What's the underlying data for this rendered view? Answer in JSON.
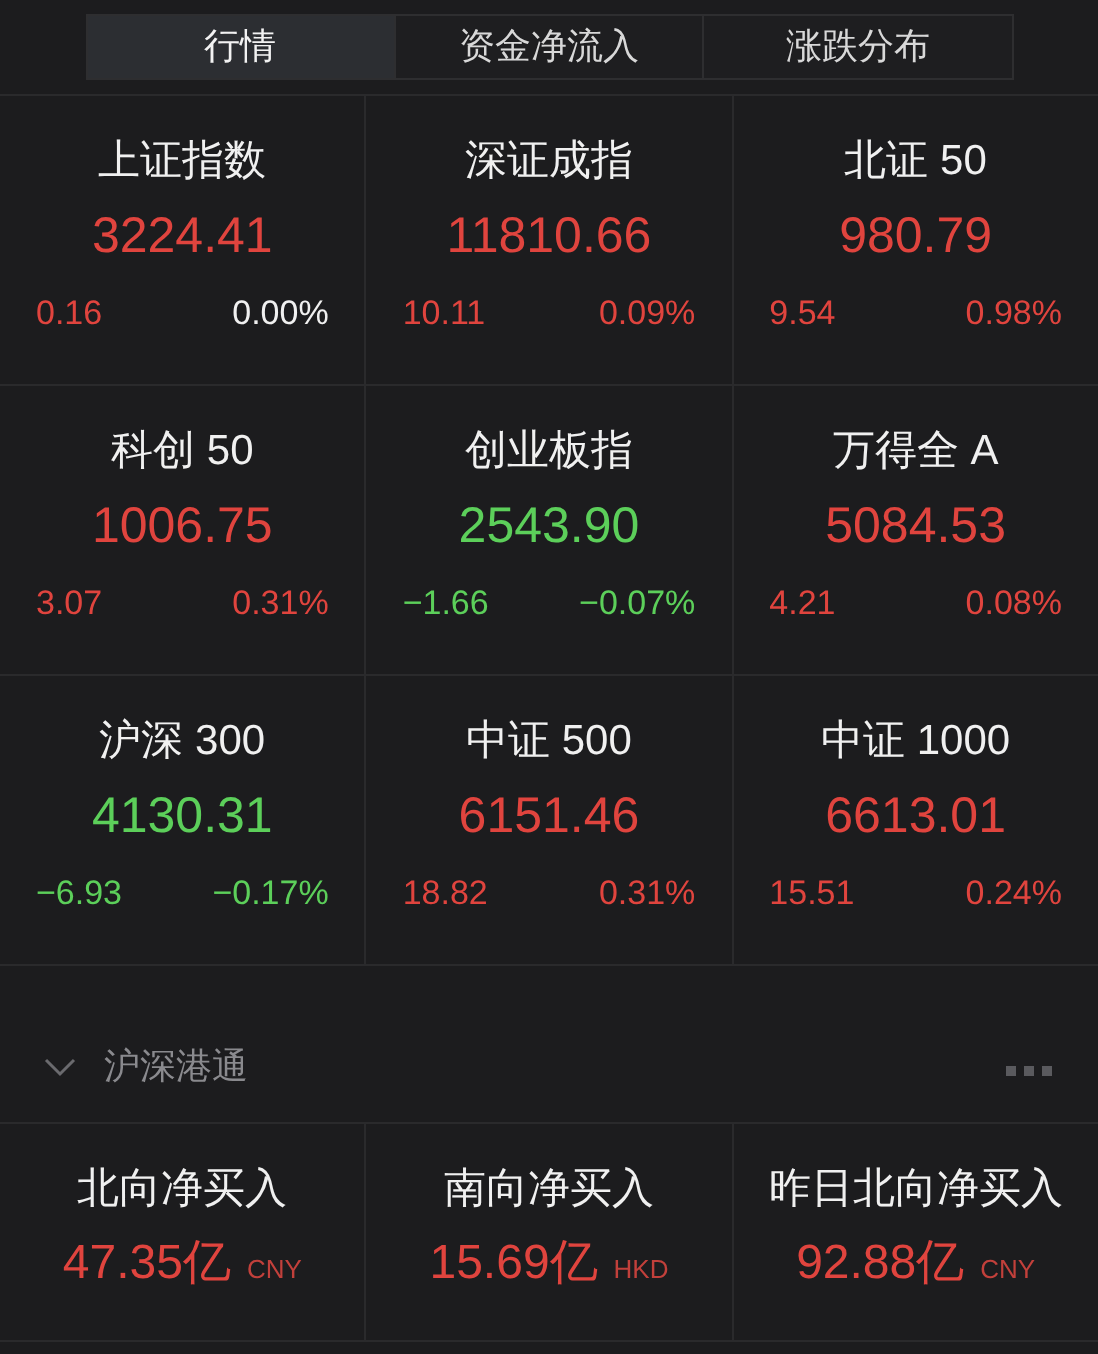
{
  "tabs": [
    {
      "label": "行情",
      "selected": true
    },
    {
      "label": "资金净流入",
      "selected": false
    },
    {
      "label": "涨跌分布",
      "selected": false
    }
  ],
  "indices": [
    {
      "name": "上证指数",
      "value": {
        "text": "3224.41",
        "color": "#e0443e"
      },
      "change": {
        "text": "0.16",
        "color": "#e0443e"
      },
      "pct": {
        "text": "0.00%",
        "color": "#f0f0f0"
      }
    },
    {
      "name": "深证成指",
      "value": {
        "text": "11810.66",
        "color": "#e0443e"
      },
      "change": {
        "text": "10.11",
        "color": "#e0443e"
      },
      "pct": {
        "text": "0.09%",
        "color": "#e0443e"
      }
    },
    {
      "name": "北证 50",
      "value": {
        "text": "980.79",
        "color": "#e0443e"
      },
      "change": {
        "text": "9.54",
        "color": "#e0443e"
      },
      "pct": {
        "text": "0.98%",
        "color": "#e0443e"
      }
    },
    {
      "name": "科创 50",
      "value": {
        "text": "1006.75",
        "color": "#e0443e"
      },
      "change": {
        "text": "3.07",
        "color": "#e0443e"
      },
      "pct": {
        "text": "0.31%",
        "color": "#e0443e"
      }
    },
    {
      "name": "创业板指",
      "value": {
        "text": "2543.90",
        "color": "#5ccf5a"
      },
      "change": {
        "text": "−1.66",
        "color": "#5ccf5a"
      },
      "pct": {
        "text": "−0.07%",
        "color": "#5ccf5a"
      }
    },
    {
      "name": "万得全 A",
      "value": {
        "text": "5084.53",
        "color": "#e0443e"
      },
      "change": {
        "text": "4.21",
        "color": "#e0443e"
      },
      "pct": {
        "text": "0.08%",
        "color": "#e0443e"
      }
    },
    {
      "name": "沪深 300",
      "value": {
        "text": "4130.31",
        "color": "#5ccf5a"
      },
      "change": {
        "text": "−6.93",
        "color": "#5ccf5a"
      },
      "pct": {
        "text": "−0.17%",
        "color": "#5ccf5a"
      }
    },
    {
      "name": "中证 500",
      "value": {
        "text": "6151.46",
        "color": "#e0443e"
      },
      "change": {
        "text": "18.82",
        "color": "#e0443e"
      },
      "pct": {
        "text": "0.31%",
        "color": "#e0443e"
      }
    },
    {
      "name": "中证 1000",
      "value": {
        "text": "6613.01",
        "color": "#e0443e"
      },
      "change": {
        "text": "15.51",
        "color": "#e0443e"
      },
      "pct": {
        "text": "0.24%",
        "color": "#e0443e"
      }
    }
  ],
  "section": {
    "title": "沪深港通",
    "expanded": true,
    "items": [
      {
        "label": "北向净买入",
        "value": "47.35亿",
        "currency": "CNY"
      },
      {
        "label": "南向净买入",
        "value": "15.69亿",
        "currency": "HKD"
      },
      {
        "label": "昨日北向净买入",
        "value": "92.88亿",
        "currency": "CNY"
      }
    ]
  }
}
